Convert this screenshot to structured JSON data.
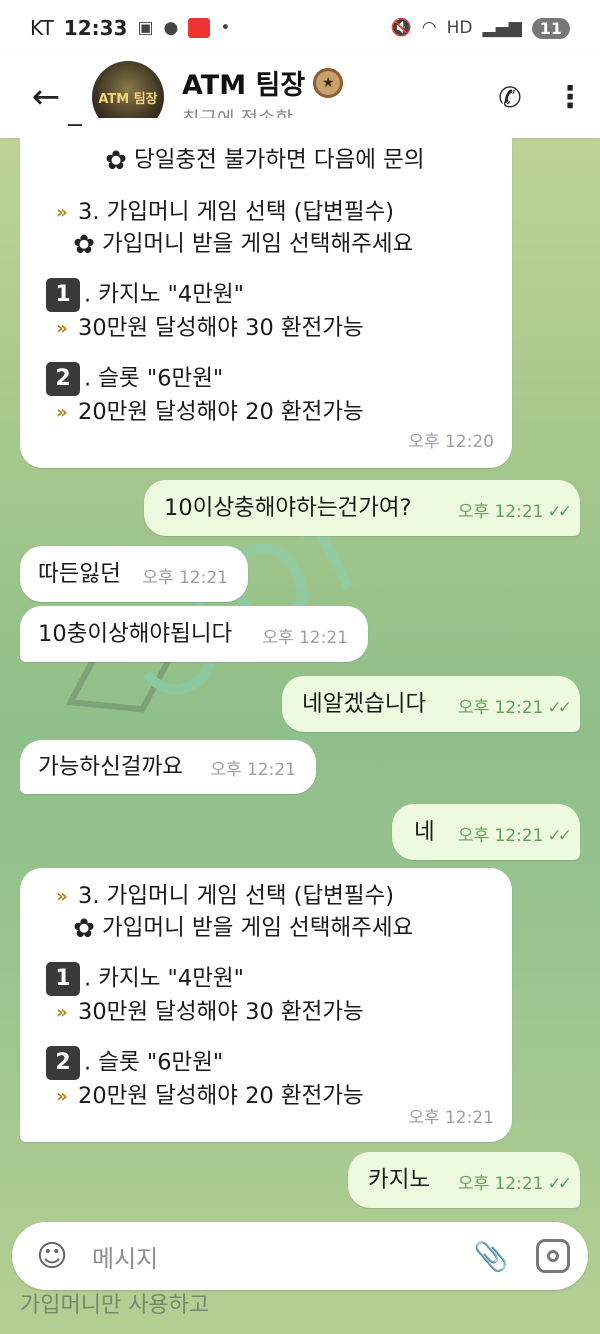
{
  "status_bar": {
    "carrier": "KT",
    "time": "12:33",
    "network": "HD",
    "battery": "11"
  },
  "header": {
    "title": "ATM 팀장",
    "subtitle": "최근에 접속함",
    "avatar_text": "ATM 팀장"
  },
  "messages": [
    {
      "dir": "in",
      "lines": [
        "당일충전 불가하면 다음에 문의",
        "",
        "3. 가입머니 게임 선택  (답변필수)",
        "가입머니 받을 게임 선택해주세요",
        "",
        ". 카지노 \"4만원\"",
        "30만원 달성해야 30 환전가능",
        "",
        ". 슬롯 \"6만원\"",
        "20만원 달성해야 20 환전가능"
      ],
      "time": "오후 12:20"
    },
    {
      "dir": "out",
      "text": "10이상충해야하는건가여?",
      "time": "오후 12:21"
    },
    {
      "dir": "in",
      "text": "따든잃던",
      "time": "오후 12:21"
    },
    {
      "dir": "in",
      "text": "10충이상해야됩니다",
      "time": "오후 12:21"
    },
    {
      "dir": "out",
      "text": "네알겠습니다",
      "time": "오후 12:21"
    },
    {
      "dir": "in",
      "text": "가능하신걸까요",
      "time": "오후 12:21"
    },
    {
      "dir": "out",
      "text": "네",
      "time": "오후 12:21"
    },
    {
      "dir": "in",
      "lines": [
        "3. 가입머니 게임 선택  (답변필수)",
        "가입머니 받을 게임 선택해주세요",
        "",
        ". 카지노 \"4만원\"",
        "30만원 달성해야 30 환전가능",
        "",
        ". 슬롯 \"6만원\"",
        "20만원 달성해야 20 환전가능"
      ],
      "time": "오후 12:21"
    },
    {
      "dir": "out",
      "text": "카지노",
      "time": "오후 12:21"
    }
  ],
  "icons": {
    "number_1": "1",
    "number_2": "2"
  },
  "composer": {
    "placeholder": "메시지"
  },
  "underlay": {
    "line1": "가입머니만 사용하고"
  },
  "colors": {
    "incoming_bubble": "#ffffff",
    "outgoing_bubble": "#eefadf",
    "outgoing_time": "#5fa45b"
  }
}
